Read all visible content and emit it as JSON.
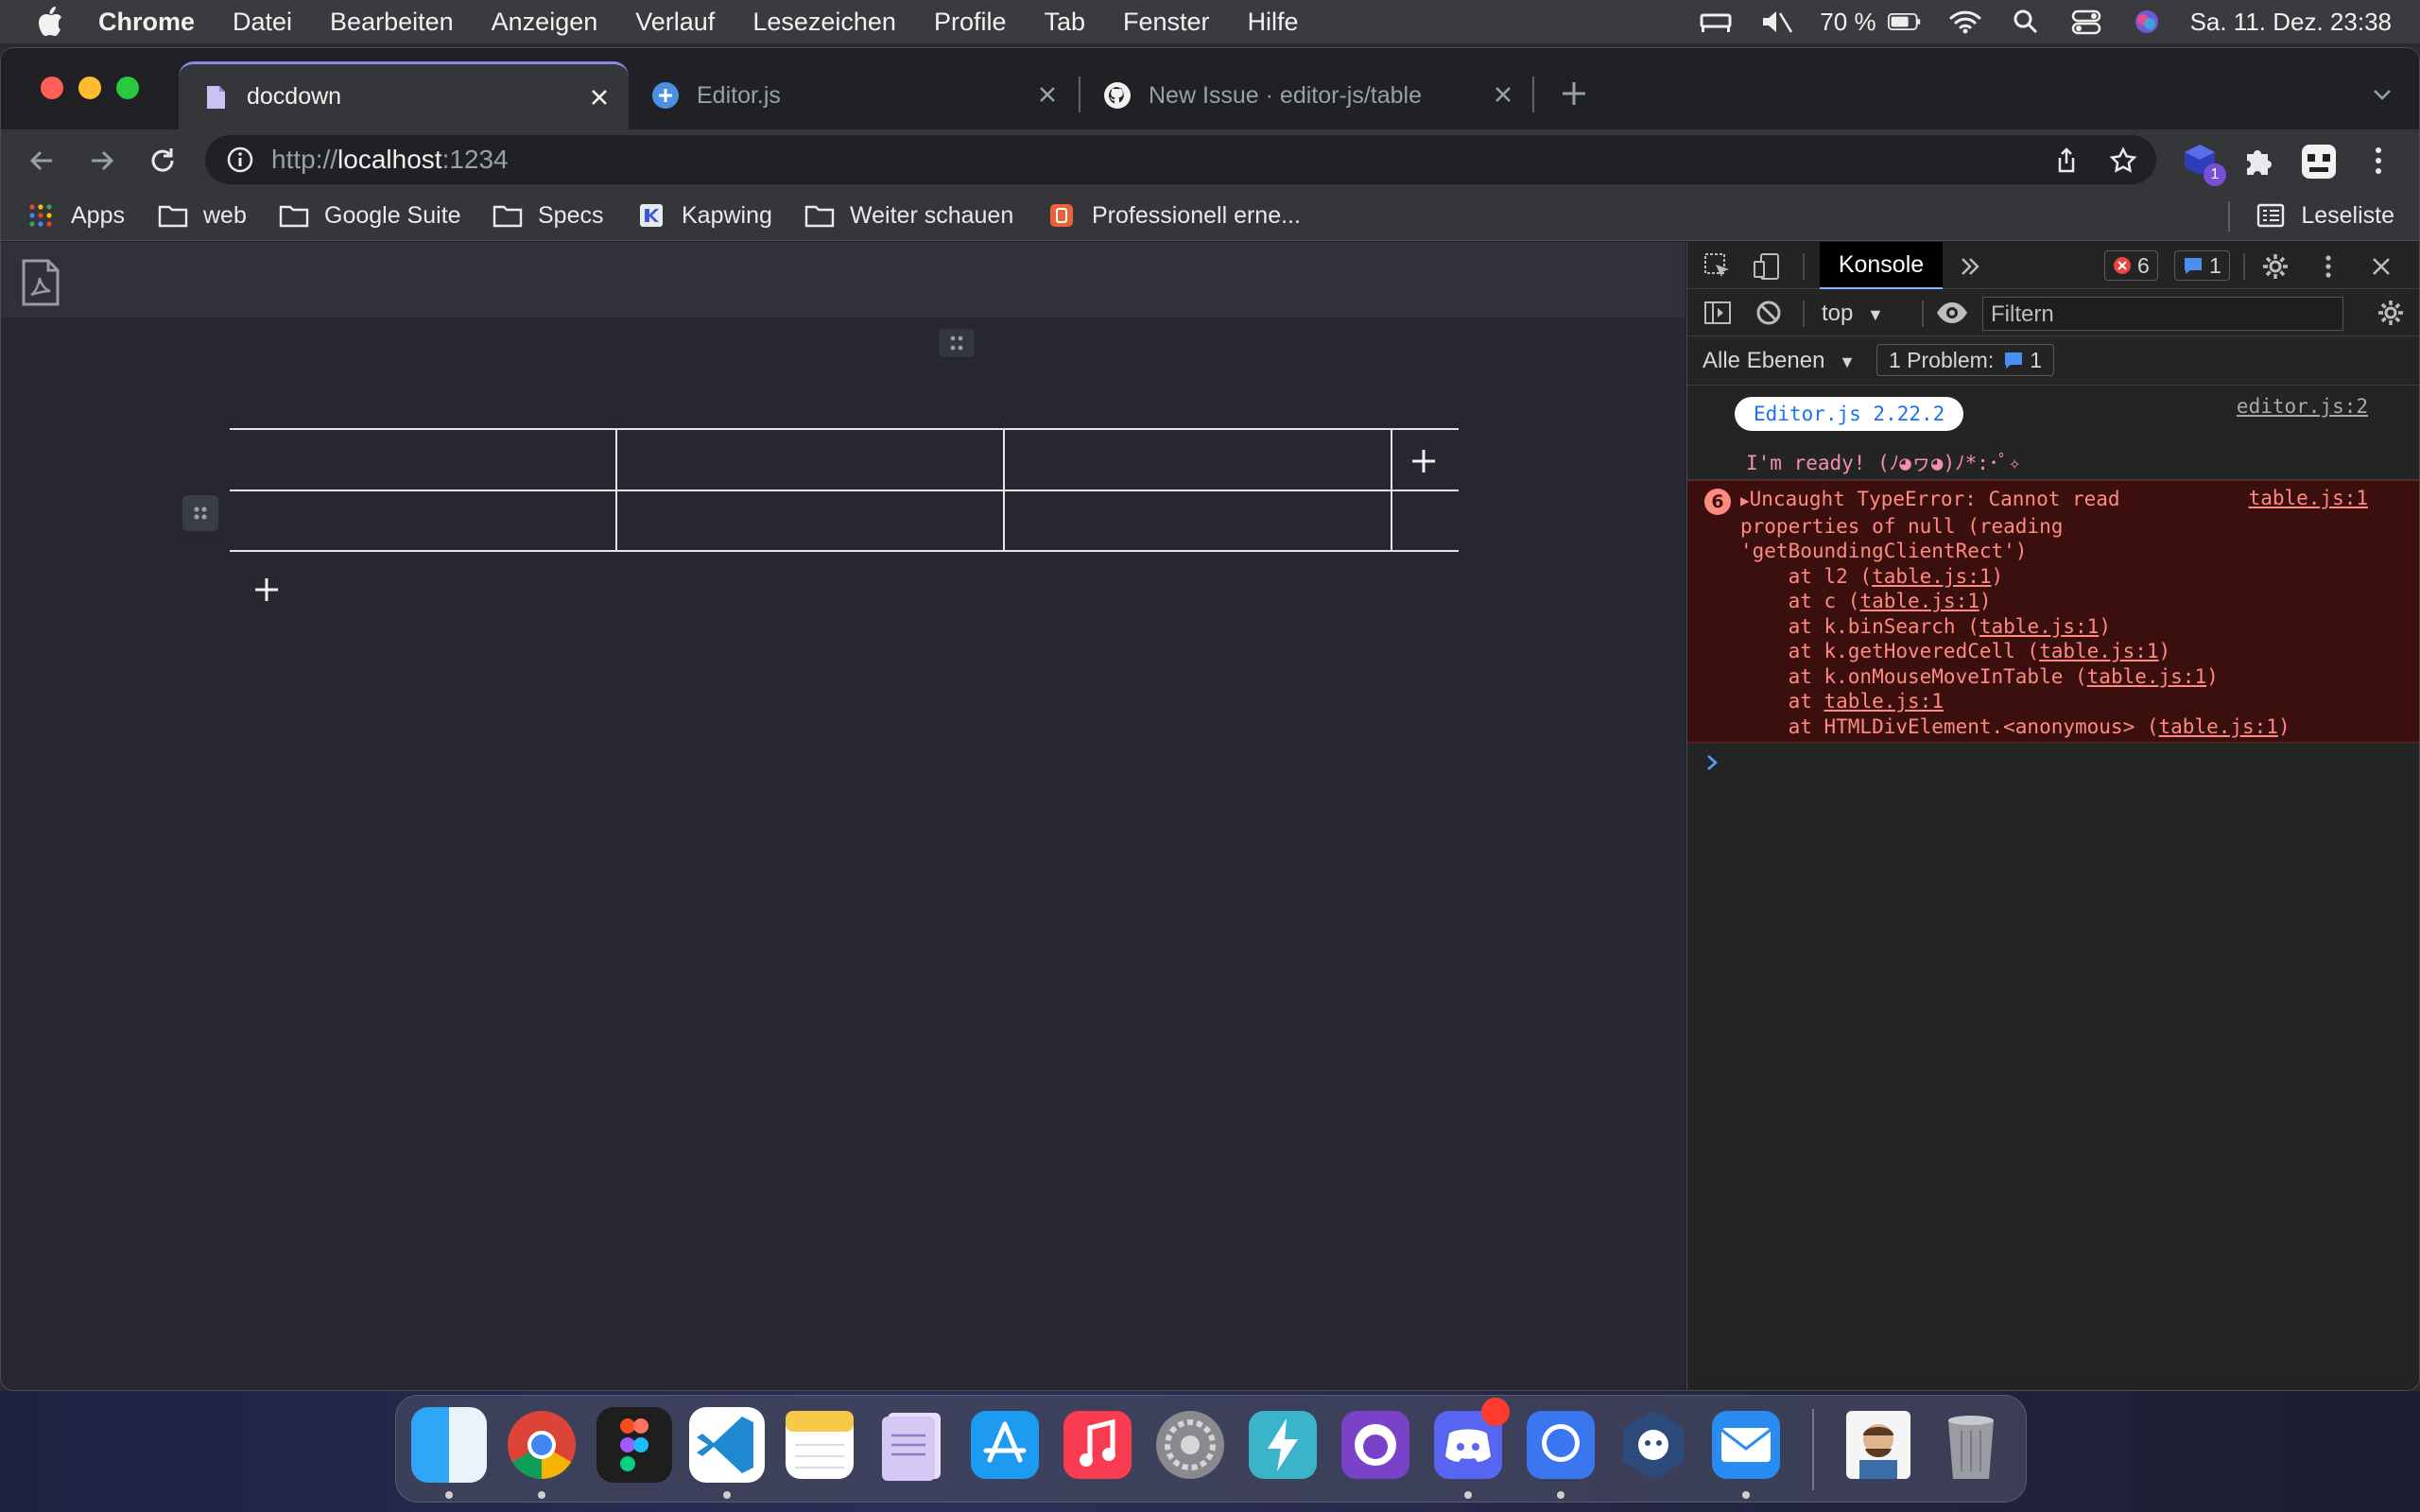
{
  "menubar": {
    "app": "Chrome",
    "items": [
      "Datei",
      "Bearbeiten",
      "Anzeigen",
      "Verlauf",
      "Lesezeichen",
      "Profile",
      "Tab",
      "Fenster",
      "Hilfe"
    ],
    "battery": "70 %",
    "datetime": "Sa. 11. Dez.  23:38"
  },
  "tabs": [
    {
      "title": "docdown",
      "active": true
    },
    {
      "title": "Editor.js",
      "active": false
    },
    {
      "title": "New Issue · editor-js/table",
      "active": false
    }
  ],
  "omnibox": {
    "scheme": "http://",
    "host": "localhost",
    "port": ":1234"
  },
  "bookmarks": {
    "items": [
      "Apps",
      "web",
      "Google Suite",
      "Specs",
      "Kapwing",
      "Weiter schauen",
      "Professionell erne..."
    ],
    "reading_list": "Leseliste"
  },
  "extension_badge": "1",
  "devtools": {
    "active_tab": "Konsole",
    "error_count": "6",
    "info_count": "1",
    "context": "top",
    "filter_placeholder": "Filtern",
    "levels": "Alle Ebenen",
    "problems_label": "1 Problem:",
    "problems_count": "1",
    "log": {
      "badge": "Editor.js 2.22.2",
      "source": "editor.js:2",
      "ready": "I'm ready! (ﾉ◕ヮ◕)ﾉ*:･ﾟ✧"
    },
    "error": {
      "count": "6",
      "source": "table.js:1",
      "message": [
        "Uncaught TypeError: Cannot read",
        "properties of null (reading",
        "'getBoundingClientRect')"
      ],
      "stack": [
        {
          "prefix": "    at l2 (",
          "link": "table.js:1",
          "suffix": ")"
        },
        {
          "prefix": "    at c (",
          "link": "table.js:1",
          "suffix": ")"
        },
        {
          "prefix": "    at k.binSearch (",
          "link": "table.js:1",
          "suffix": ")"
        },
        {
          "prefix": "    at k.getHoveredCell (",
          "link": "table.js:1",
          "suffix": ")"
        },
        {
          "prefix": "    at k.onMouseMoveInTable (",
          "link": "table.js:1",
          "suffix": ")"
        },
        {
          "prefix": "    at ",
          "link": "table.js:1",
          "suffix": ""
        },
        {
          "prefix": "    at HTMLDivElement.<anonymous> (",
          "link": "table.js:1",
          "suffix": ")"
        }
      ]
    }
  },
  "colors": {
    "accent": "#8e88e8",
    "error_bg": "#3c0f0f",
    "error_text": "#ff8a80",
    "link_blue": "#1a73e8"
  },
  "dock_apps": [
    "finder-icon",
    "chrome-icon",
    "figma-icon",
    "vscode-icon",
    "notes-icon",
    "pages-icon",
    "app-store-icon",
    "music-icon",
    "system-preferences-icon",
    "reeder-icon",
    "github-desktop-icon",
    "discord-icon",
    "signal-icon",
    "mountain-duck-icon",
    "mail-icon",
    "avatar-icon",
    "trash-icon"
  ]
}
